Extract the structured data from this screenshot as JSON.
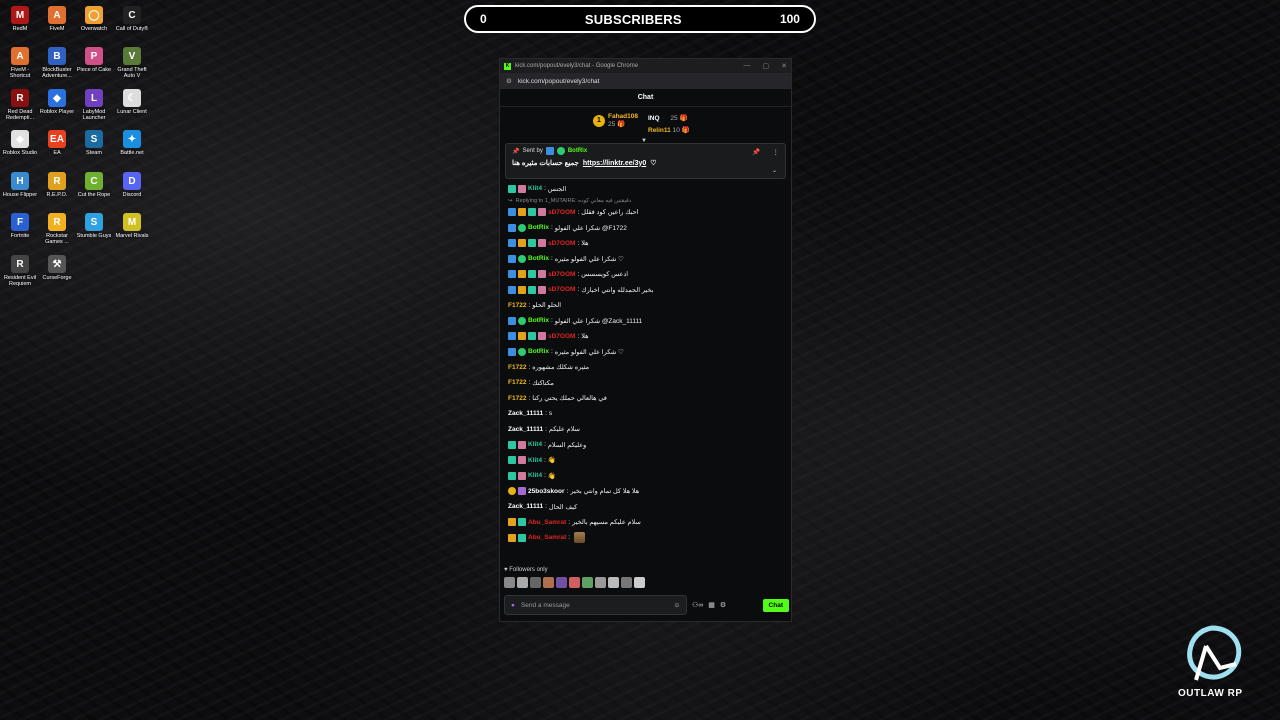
{
  "desktop": {
    "icons": [
      {
        "label": "RedM",
        "icon": "redm-icon",
        "color": "#b01818",
        "glyph": "M"
      },
      {
        "label": "FiveM",
        "icon": "fivem-icon",
        "color": "#e07030",
        "glyph": "A"
      },
      {
        "label": "Overwatch",
        "icon": "overwatch-icon",
        "color": "#f0a030",
        "glyph": "◯"
      },
      {
        "label": "Call of Duty®",
        "icon": "cod-icon",
        "color": "#222",
        "glyph": "C"
      },
      {
        "label": "FiveM - Shortcut",
        "icon": "fivem-shortcut-icon",
        "color": "#e07030",
        "glyph": "A"
      },
      {
        "label": "BlockBuster Adventure...",
        "icon": "blockbuster-icon",
        "color": "#3060c0",
        "glyph": "B"
      },
      {
        "label": "Piece of Cake",
        "icon": "cake-icon",
        "color": "#d0508a",
        "glyph": "P"
      },
      {
        "label": "Grand Theft Auto V",
        "icon": "gta-icon",
        "color": "#5a7a3a",
        "glyph": "V"
      },
      {
        "label": "Red Dead Redempti...",
        "icon": "rdr-icon",
        "color": "#8a1010",
        "glyph": "R"
      },
      {
        "label": "Roblox Player",
        "icon": "roblox-icon",
        "color": "#2a70e0",
        "glyph": "◆"
      },
      {
        "label": "LabyMod Launcher",
        "icon": "labymod-icon",
        "color": "#7040c0",
        "glyph": "L"
      },
      {
        "label": "Lunar Client",
        "icon": "lunar-icon",
        "color": "#ddd",
        "glyph": "☾"
      },
      {
        "label": "Roblox Studio",
        "icon": "roblox-studio-icon",
        "color": "#e0e0e0",
        "glyph": "◆"
      },
      {
        "label": "EA",
        "icon": "ea-icon",
        "color": "#e84020",
        "glyph": "EA"
      },
      {
        "label": "Steam",
        "icon": "steam-icon",
        "color": "#1b6aa0",
        "glyph": "S"
      },
      {
        "label": "Battle.net",
        "icon": "battlenet-icon",
        "color": "#1a8fe0",
        "glyph": "✦"
      },
      {
        "label": "House Flipper",
        "icon": "houseflipper-icon",
        "color": "#3a8ad0",
        "glyph": "H"
      },
      {
        "label": "R.E.P.O.",
        "icon": "repo-icon",
        "color": "#e0a020",
        "glyph": "R"
      },
      {
        "label": "Cut the Rope",
        "icon": "cuttherope-icon",
        "color": "#70b030",
        "glyph": "C"
      },
      {
        "label": "Discord",
        "icon": "discord-icon",
        "color": "#5865f2",
        "glyph": "D"
      },
      {
        "label": "Fortnite",
        "icon": "fortnite-icon",
        "color": "#2a60d0",
        "glyph": "F"
      },
      {
        "label": "Rockstar Games ...",
        "icon": "rockstar-icon",
        "color": "#f0b020",
        "glyph": "R"
      },
      {
        "label": "Stumble Guys",
        "icon": "stumbleguys-icon",
        "color": "#30a0e0",
        "glyph": "S"
      },
      {
        "label": "Marvel Rivals",
        "icon": "marvelrivals-icon",
        "color": "#d0c020",
        "glyph": "M"
      },
      {
        "label": "Resident Evil Requiem",
        "icon": "residentevil-icon",
        "color": "#444",
        "glyph": "R"
      },
      {
        "label": "CurseForge",
        "icon": "curseforge-icon",
        "color": "#555",
        "glyph": "⚒"
      }
    ]
  },
  "subscribers": {
    "left": "0",
    "title": "SUBSCRIBERS",
    "right": "100"
  },
  "browser": {
    "title": "kick.com/popout/evely3/chat - Google Chrome",
    "url": "kick.com/popout/evely3/chat"
  },
  "chat": {
    "header": "Chat",
    "leaders": [
      {
        "name": "Fahad108",
        "count": "25"
      },
      {
        "name": "INQ",
        "count": "25"
      },
      {
        "name": "Relin11",
        "count": "10"
      }
    ],
    "pinned": {
      "sent_by": "Sent by",
      "bot": "BotRix",
      "text": "جميع حسابات مثيره هنا",
      "link": "https://linktr.ee/3y0"
    },
    "messages": [
      {
        "user": "Klit4",
        "color": "#2dc7a3",
        "text": "الجنس",
        "badges": [
          "teal",
          "gift"
        ]
      },
      {
        "reply": "Replying to 1_MUTAIRE: دقيقتين فيه معاني كوده"
      },
      {
        "user": "sD7OOM",
        "color": "#e02424",
        "text": "احبك راعين كود فقلل",
        "badges": [
          "blue",
          "gold",
          "teal",
          "gift"
        ]
      },
      {
        "user": "BotRix",
        "color": "#53fc18",
        "text": "شكرا علي الفولو @F1722",
        "badges": [
          "blue",
          "green"
        ]
      },
      {
        "user": "sD7OOM",
        "color": "#e02424",
        "text": "هلا",
        "badges": [
          "blue",
          "gold",
          "teal",
          "gift"
        ]
      },
      {
        "user": "BotRix",
        "color": "#53fc18",
        "text": "شكرا علي الفولو مثيره ♡",
        "badges": [
          "blue",
          "green"
        ]
      },
      {
        "user": "sD7OOM",
        "color": "#e02424",
        "text": "ادعس كويسسس",
        "badges": [
          "blue",
          "gold",
          "teal",
          "gift"
        ]
      },
      {
        "user": "sD7OOM",
        "color": "#e02424",
        "text": "بخير الحمدلله وانتي اخبارك",
        "badges": [
          "blue",
          "gold",
          "teal",
          "gift"
        ]
      },
      {
        "user": "F1722",
        "color": "#f5b820",
        "text": "الحلو الحلو",
        "badges": []
      },
      {
        "user": "BotRix",
        "color": "#53fc18",
        "text": "شكرا علي الفولو @Zack_11111",
        "badges": [
          "blue",
          "green"
        ]
      },
      {
        "user": "sD7OOM",
        "color": "#e02424",
        "text": "هلا",
        "badges": [
          "blue",
          "gold",
          "teal",
          "gift"
        ]
      },
      {
        "user": "BotRix",
        "color": "#53fc18",
        "text": "شكرا علي الفولو مثيره ♡",
        "badges": [
          "blue",
          "green"
        ]
      },
      {
        "user": "F1722",
        "color": "#f5b820",
        "text": "مثيره شكلك مشهوره",
        "badges": []
      },
      {
        "user": "F1722",
        "color": "#f5b820",
        "text": "مكتاكتك",
        "badges": []
      },
      {
        "user": "F1722",
        "color": "#f5b820",
        "text": "في هالعالي حملك يحتي ركنا",
        "badges": []
      },
      {
        "user": "Zack_11111",
        "color": "#ffffff",
        "text": "s",
        "badges": []
      },
      {
        "user": "Zack_11111",
        "color": "#ffffff",
        "text": "سلام عليكم",
        "badges": []
      },
      {
        "user": "Klit4",
        "color": "#2dc7a3",
        "text": "وعليكم السلام",
        "badges": [
          "teal",
          "gift"
        ]
      },
      {
        "user": "Klit4",
        "color": "#2dc7a3",
        "text": "👋",
        "badges": [
          "teal",
          "gift"
        ]
      },
      {
        "user": "Klit4",
        "color": "#2dc7a3",
        "text": "👋",
        "badges": [
          "teal",
          "gift"
        ]
      },
      {
        "user": "25bo3skoor",
        "color": "#ffffff",
        "text": "هلا هلا كل تمام وانتي بخير",
        "badges": [
          "yel",
          "pur"
        ]
      },
      {
        "user": "Zack_11111",
        "color": "#ffffff",
        "text": "كيف الحال",
        "badges": []
      },
      {
        "user": "Abu_Samrat",
        "color": "#e02424",
        "text": "سلام عليكم مسيهم بالخير",
        "badges": [
          "gold",
          "teal"
        ]
      },
      {
        "user": "Abu_Samrat",
        "color": "#e02424",
        "text": "",
        "badges": [
          "gold",
          "teal"
        ],
        "emote": true
      }
    ],
    "followers_only": "Followers only",
    "input_placeholder": "Send a message",
    "send_label": "Chat"
  },
  "logo": {
    "text": "OUTLAW RP"
  }
}
